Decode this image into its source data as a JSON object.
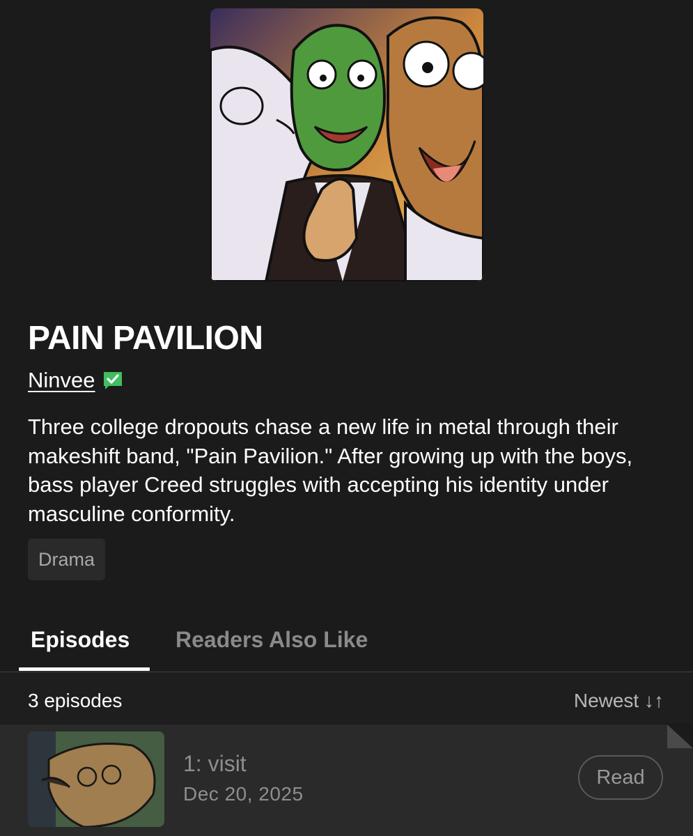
{
  "series": {
    "title": "PAIN PAVILION",
    "author": "Ninvee",
    "description": "Three college dropouts chase a new life in metal through their makeshift band, \"Pain Pavilion.\" After growing up with the boys, bass player Creed struggles with accepting his identity under masculine conformity.",
    "genre_tag": "Drama"
  },
  "tabs": [
    {
      "label": "Episodes",
      "active": true
    },
    {
      "label": "Readers Also Like",
      "active": false
    }
  ],
  "episode_list": {
    "count_label": "3 episodes",
    "sort_label": "Newest ↓↑",
    "episodes": [
      {
        "title": "1: visit",
        "date": "Dec 20, 2025",
        "action_label": "Read"
      }
    ]
  },
  "colors": {
    "background": "#1b1b1b",
    "verified_badge": "#3fbf5f",
    "tab_active": "#ffffff",
    "tab_inactive": "#8a8a8a"
  },
  "icons": {
    "verified": "verified-check-icon",
    "sort": "sort-arrows-icon"
  }
}
